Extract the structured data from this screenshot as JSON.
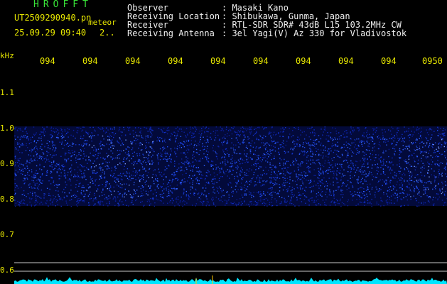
{
  "app": {
    "brand": "HROFFT",
    "file_name": "UT2509290940.pn",
    "file_suffix": "meteor",
    "datetime": "25.09.29 09:40",
    "page_indicator": "2.."
  },
  "info": {
    "rows": [
      {
        "label": "Observer",
        "value": ": Masaki Kano"
      },
      {
        "label": "Receiving Location",
        "value": ": Shibukawa, Gunma, Japan"
      },
      {
        "label": "Receiver",
        "value": ": RTL-SDR SDR# 43dB L15 103.2MHz CW"
      },
      {
        "label": "Receiving Antenna",
        "value": ": 3el Yagi(V) Az 330 for Vladivostok"
      }
    ]
  },
  "axes": {
    "y_unit": "kHz",
    "x_ticks": [
      "094",
      "094",
      "094",
      "094",
      "094",
      "094",
      "094",
      "094",
      "094",
      "0950"
    ],
    "y_ticks": [
      "1.1",
      "1.0",
      "0.9",
      "0.8",
      "0.7",
      "0.6"
    ]
  },
  "colors": {
    "background": "#000000",
    "label_text": "#e8e800",
    "info_text": "#f0f0f0",
    "brand_text": "#39e639",
    "signal_dim": "#0a1a7a",
    "signal_bright": "#7a9cff",
    "baseline": "#00e5ff",
    "marker": "#ffcc00",
    "grid_line": "#c8c8c8"
  }
}
